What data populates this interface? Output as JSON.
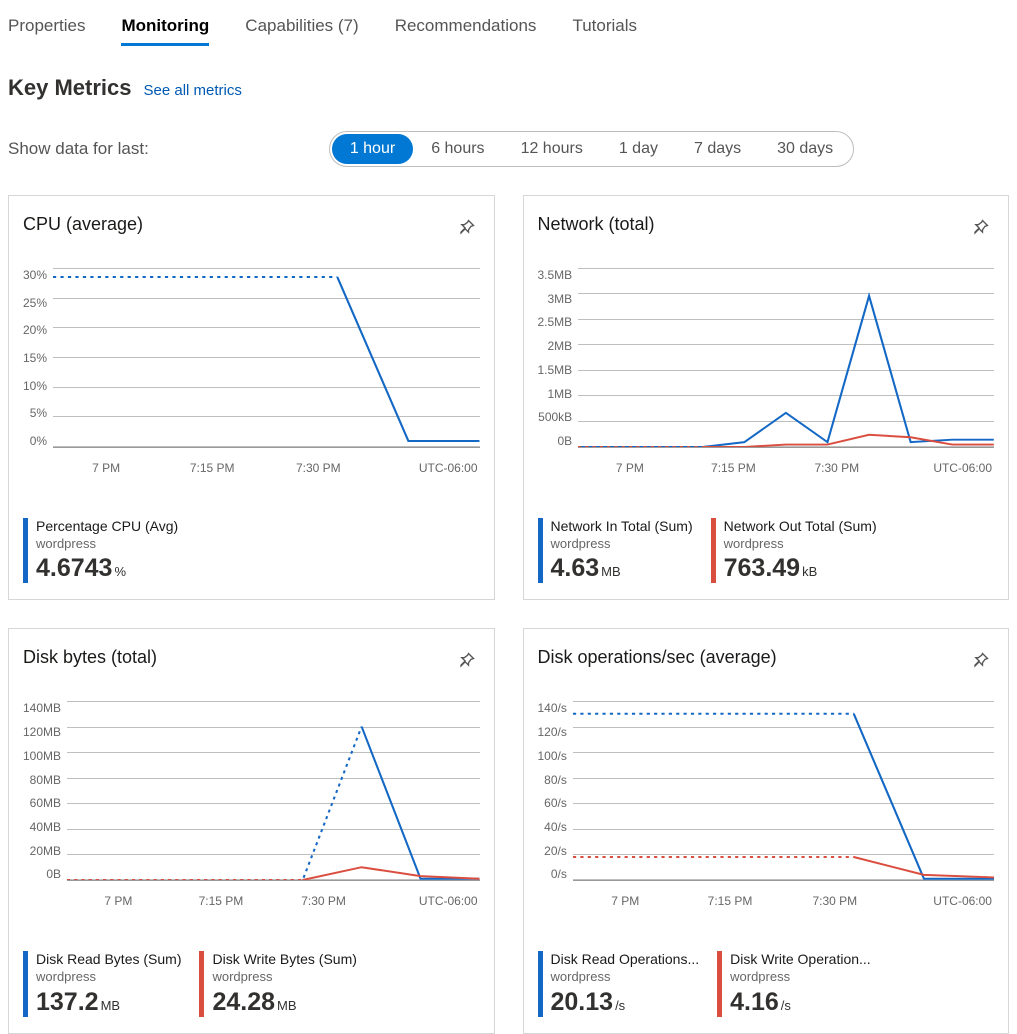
{
  "tabs": [
    {
      "label": "Properties",
      "active": false
    },
    {
      "label": "Monitoring",
      "active": true
    },
    {
      "label": "Capabilities (7)",
      "active": false
    },
    {
      "label": "Recommendations",
      "active": false
    },
    {
      "label": "Tutorials",
      "active": false
    }
  ],
  "heading": {
    "title": "Key Metrics",
    "link": "See all metrics"
  },
  "time": {
    "label": "Show data for last:",
    "options": [
      "1 hour",
      "6 hours",
      "12 hours",
      "1 day",
      "7 days",
      "30 days"
    ],
    "selected": "1 hour"
  },
  "timezone": "UTC-06:00",
  "x_ticks": [
    "7 PM",
    "7:15 PM",
    "7:30 PM"
  ],
  "colors": {
    "blue": "#1368c5",
    "red": "#da4e3f"
  },
  "chart_data": [
    {
      "id": "cpu",
      "title": "CPU (average)",
      "type": "line",
      "xlabel": "",
      "ylabel": "",
      "y_ticks": [
        "30%",
        "25%",
        "20%",
        "15%",
        "10%",
        "5%",
        "0%"
      ],
      "ylim": [
        0,
        30
      ],
      "x": [
        "6:45 PM",
        "7 PM",
        "7:15 PM",
        "7:30 PM",
        "7:36 PM",
        "7:38 PM",
        "7:45 PM"
      ],
      "series": [
        {
          "name": "Percentage CPU (Avg)",
          "color": "blue",
          "values": [
            28.5,
            28.5,
            28.5,
            28.5,
            28.5,
            1,
            1
          ],
          "style": {
            "dashed_until_index": 4
          }
        }
      ],
      "metrics": [
        {
          "label": "Percentage CPU (Avg)",
          "sub": "wordpress",
          "value": "4.6743",
          "unit": "%",
          "color": "blue"
        }
      ]
    },
    {
      "id": "network",
      "title": "Network (total)",
      "type": "line",
      "y_ticks": [
        "3.5MB",
        "3MB",
        "2.5MB",
        "2MB",
        "1.5MB",
        "1MB",
        "500kB",
        "0B"
      ],
      "ylim_bytes": [
        0,
        3670016
      ],
      "x": [
        "6:45 PM",
        "7 PM",
        "7:15 PM",
        "7:30 PM",
        "7:33 PM",
        "7:35 PM",
        "7:36 PM",
        "7:38 PM",
        "7:39 PM",
        "7:40 PM",
        "7:45 PM"
      ],
      "series": [
        {
          "name": "Network In Total (Sum)",
          "color": "blue",
          "values_bytes": [
            0,
            0,
            0,
            0,
            100000,
            700000,
            100000,
            3100000,
            100000,
            150000,
            150000
          ]
        },
        {
          "name": "Network Out Total (Sum)",
          "color": "red",
          "values_bytes": [
            0,
            0,
            0,
            0,
            0,
            50000,
            50000,
            250000,
            200000,
            50000,
            50000
          ],
          "style": {
            "dashed_until_index": 3
          }
        }
      ],
      "metrics": [
        {
          "label": "Network In Total (Sum)",
          "sub": "wordpress",
          "value": "4.63",
          "unit": "MB",
          "color": "blue"
        },
        {
          "label": "Network Out Total (Sum)",
          "sub": "wordpress",
          "value": "763.49",
          "unit": "kB",
          "color": "red"
        }
      ]
    },
    {
      "id": "disk_bytes",
      "title": "Disk bytes (total)",
      "type": "line",
      "y_ticks": [
        "140MB",
        "120MB",
        "100MB",
        "80MB",
        "60MB",
        "40MB",
        "20MB",
        "0B"
      ],
      "ylim_mb": [
        0,
        140
      ],
      "x": [
        "6:45 PM",
        "7 PM",
        "7:15 PM",
        "7:30 PM",
        "7:34 PM",
        "7:36 PM",
        "7:38 PM",
        "7:45 PM"
      ],
      "series": [
        {
          "name": "Disk Read Bytes (Sum)",
          "color": "blue",
          "values_mb": [
            0,
            0,
            0,
            0,
            0,
            120,
            1,
            1
          ],
          "style": {
            "dashed_until_index": 5
          }
        },
        {
          "name": "Disk Write Bytes (Sum)",
          "color": "red",
          "values_mb": [
            0,
            0,
            0,
            0,
            0,
            10,
            3,
            1
          ],
          "style": {
            "dashed_until_index": 4
          }
        }
      ],
      "metrics": [
        {
          "label": "Disk Read Bytes (Sum)",
          "sub": "wordpress",
          "value": "137.2",
          "unit": "MB",
          "color": "blue"
        },
        {
          "label": "Disk Write Bytes (Sum)",
          "sub": "wordpress",
          "value": "24.28",
          "unit": "MB",
          "color": "red"
        }
      ]
    },
    {
      "id": "disk_ops",
      "title": "Disk operations/sec (average)",
      "type": "line",
      "y_ticks": [
        "140/s",
        "120/s",
        "100/s",
        "80/s",
        "60/s",
        "40/s",
        "20/s",
        "0/s"
      ],
      "ylim": [
        0,
        140
      ],
      "x": [
        "6:45 PM",
        "7 PM",
        "7:15 PM",
        "7:30 PM",
        "7:36 PM",
        "7:38 PM",
        "7:45 PM"
      ],
      "series": [
        {
          "name": "Disk Read Operations/Sec (Avg)",
          "color": "blue",
          "values": [
            130,
            130,
            130,
            130,
            130,
            1,
            1
          ],
          "style": {
            "dashed_until_index": 4
          }
        },
        {
          "name": "Disk Write Operations/Sec (Avg)",
          "color": "red",
          "values": [
            18,
            18,
            18,
            18,
            18,
            4,
            2
          ],
          "style": {
            "dashed_until_index": 4
          }
        }
      ],
      "metrics": [
        {
          "label": "Disk Read Operations...",
          "sub": "wordpress",
          "value": "20.13",
          "unit": "/s",
          "color": "blue"
        },
        {
          "label": "Disk Write Operation...",
          "sub": "wordpress",
          "value": "4.16",
          "unit": "/s",
          "color": "red"
        }
      ]
    }
  ]
}
